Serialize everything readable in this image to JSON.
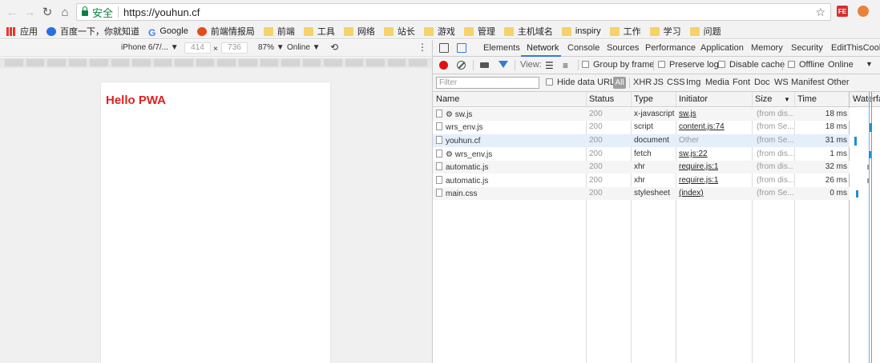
{
  "browser": {
    "secure_label": "安全",
    "url": "https://youhun.cf",
    "ext_label": "FE"
  },
  "bookmarks": [
    "应用",
    "百度一下，你就知道",
    "Google",
    "前端情报局",
    "前端",
    "工具",
    "网络",
    "站长",
    "游戏",
    "管理",
    "主机域名",
    "inspiry",
    "工作",
    "学习",
    "问题"
  ],
  "device_toolbar": {
    "device": "iPhone 6/7/...",
    "width": "414",
    "height": "736",
    "times": "×",
    "zoom": "87%",
    "throttle": "Online"
  },
  "page": {
    "heading": "Hello PWA",
    "heading_color": "#e02020"
  },
  "devtools": {
    "tabs": [
      "Elements",
      "Network",
      "Console",
      "Sources",
      "Performance",
      "Application",
      "Memory",
      "Security",
      "EditThisCookie"
    ],
    "active_tab": "Network",
    "toolbar": {
      "view_label": "View:",
      "group_by_frame": "Group by frame",
      "preserve_log": "Preserve log",
      "disable_cache": "Disable cache",
      "offline": "Offline",
      "throttle": "Online"
    },
    "filter": {
      "placeholder": "Filter",
      "hide_data_urls": "Hide data URLs",
      "all": "All",
      "types": [
        "XHR",
        "JS",
        "CSS",
        "Img",
        "Media",
        "Font",
        "Doc",
        "WS",
        "Manifest",
        "Other"
      ]
    },
    "columns": [
      "Name",
      "Status",
      "Type",
      "Initiator",
      "Size",
      "Time",
      "Waterfall"
    ],
    "rows": [
      {
        "name": "⚙ sw.js",
        "status": "200",
        "type": "x-javascript",
        "initiator": "sw.js",
        "initiator_link": true,
        "size": "(from dis...",
        "time": "18 ms"
      },
      {
        "name": "wrs_env.js",
        "status": "200",
        "type": "script",
        "initiator": "content.js:74",
        "initiator_link": true,
        "size": "(from Se...",
        "time": "18 ms"
      },
      {
        "name": "youhun.cf",
        "status": "200",
        "type": "document",
        "initiator": "Other",
        "initiator_link": false,
        "size": "(from Se...",
        "time": "31 ms"
      },
      {
        "name": "⚙ wrs_env.js",
        "status": "200",
        "type": "fetch",
        "initiator": "sw.js:22",
        "initiator_link": true,
        "size": "(from dis...",
        "time": "1 ms"
      },
      {
        "name": "automatic.js",
        "status": "200",
        "type": "xhr",
        "initiator": "require.js:1",
        "initiator_link": true,
        "size": "(from dis...",
        "time": "32 ms"
      },
      {
        "name": "automatic.js",
        "status": "200",
        "type": "xhr",
        "initiator": "require.js:1",
        "initiator_link": true,
        "size": "(from dis...",
        "time": "26 ms"
      },
      {
        "name": "main.css",
        "status": "200",
        "type": "stylesheet",
        "initiator": "(index)",
        "initiator_link": true,
        "size": "(from Se...",
        "time": "0 ms"
      }
    ]
  }
}
